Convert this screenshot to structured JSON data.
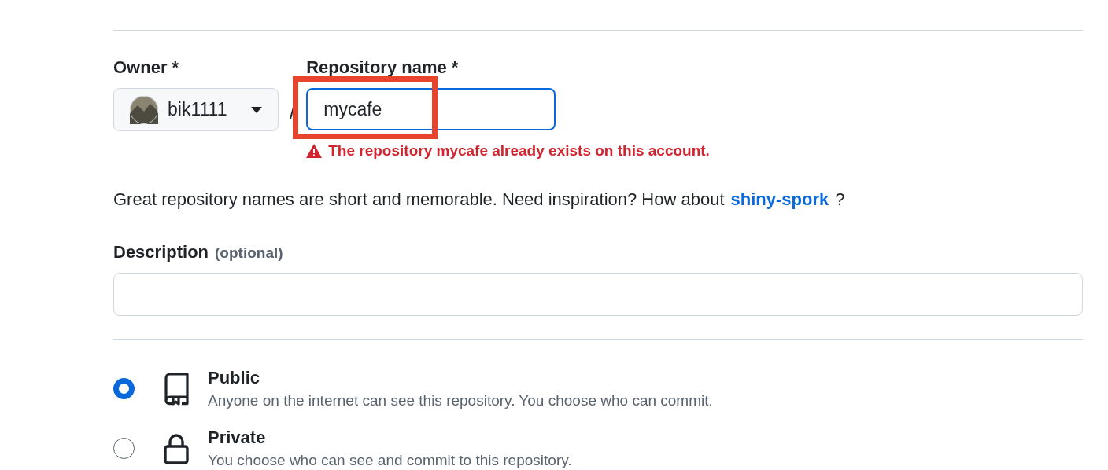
{
  "owner": {
    "label": "Owner *",
    "value": "bik1111"
  },
  "separator": "/",
  "repository_name": {
    "label": "Repository name *",
    "value": "mycafe",
    "error": "The repository mycafe already exists on this account."
  },
  "name_hint": {
    "text": "Great repository names are short and memorable. Need inspiration? How about",
    "suggestion": "shiny-spork",
    "end": "?"
  },
  "description": {
    "label": "Description",
    "optional": "(optional)"
  },
  "visibility": [
    {
      "kind": "public",
      "label": "Public",
      "text": "Anyone on the internet can see this repository. You choose who can commit.",
      "selected": true
    },
    {
      "kind": "private",
      "label": "Private",
      "text": "You choose who can see and commit to this repository.",
      "selected": false
    }
  ],
  "annotation": {
    "color": "#e8432b"
  }
}
